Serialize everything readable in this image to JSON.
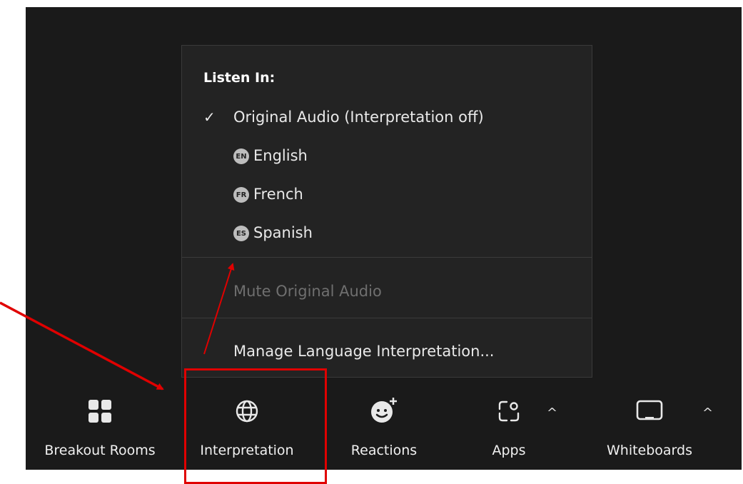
{
  "menu": {
    "header": "Listen In:",
    "items": [
      {
        "label": "Original Audio (Interpretation off)",
        "checked": true,
        "check_glyph": "✓"
      },
      {
        "label": "English",
        "badge": "EN"
      },
      {
        "label": "French",
        "badge": "FR"
      },
      {
        "label": "Spanish",
        "badge": "ES"
      }
    ],
    "mute_label": "Mute Original Audio",
    "manage_label": "Manage Language Interpretation..."
  },
  "toolbar": {
    "items": [
      {
        "label": "Breakout Rooms",
        "icon": "grid-icon"
      },
      {
        "label": "Interpretation",
        "icon": "globe-icon"
      },
      {
        "label": "Reactions",
        "icon": "smile-plus-icon"
      },
      {
        "label": "Apps",
        "icon": "apps-icon",
        "caret": "^"
      },
      {
        "label": "Whiteboards",
        "icon": "whiteboard-icon",
        "caret": "^"
      }
    ]
  },
  "colors": {
    "background": "#1a1a1a",
    "menu_bg": "#232323",
    "annotation": "#e00000",
    "disabled_text": "#6f6f6f"
  }
}
